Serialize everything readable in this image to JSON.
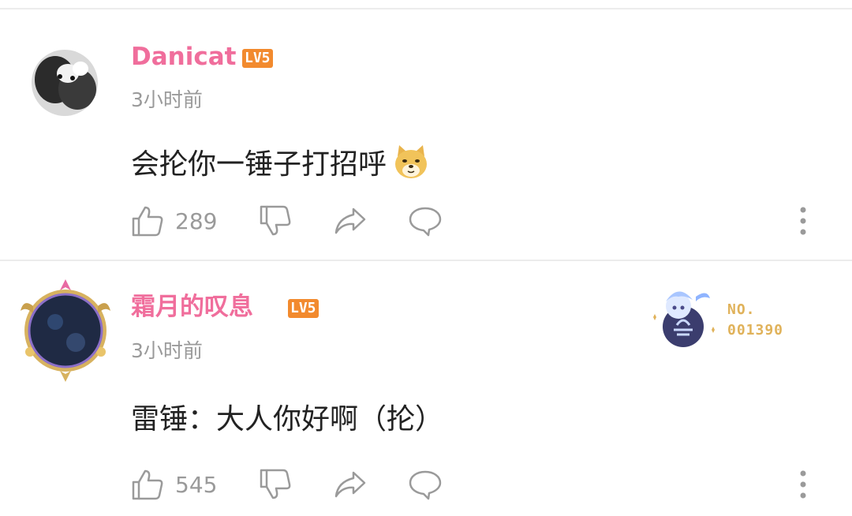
{
  "comments": [
    {
      "username": "Danicat",
      "level": "LV5",
      "time": "3小时前",
      "text": "会抡你一锤子打招呼",
      "emoji": "doge-emoji",
      "likes": "289",
      "colors": {
        "username": "#f06e9c",
        "level": "#f28a2e"
      }
    },
    {
      "username": "霜月的叹息",
      "level": "LV5",
      "time": "3小时前",
      "text": "雷锤：大人你好啊（抡）",
      "likes": "545",
      "medal": {
        "label": "NO.",
        "number": "001390"
      }
    }
  ]
}
